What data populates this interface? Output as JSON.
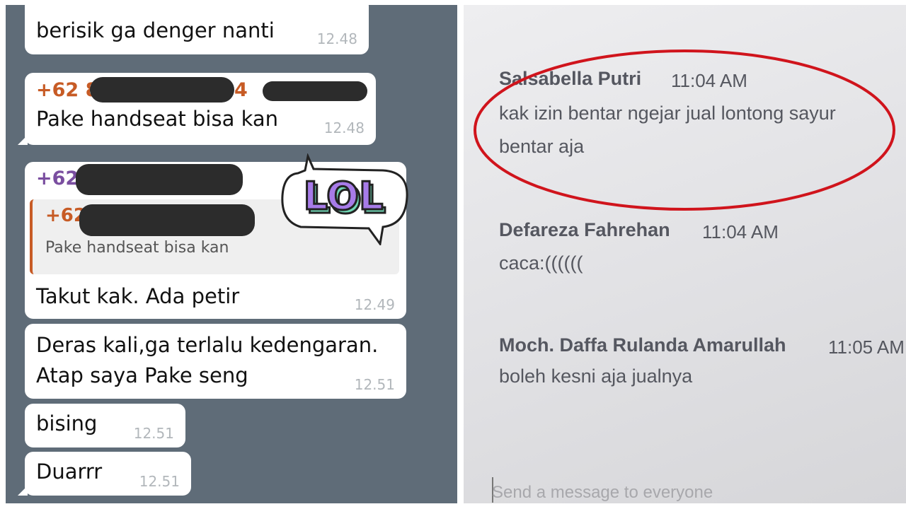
{
  "left_chat": {
    "messages": [
      {
        "text": "berisik ga denger nanti",
        "time": "12.48"
      },
      {
        "sender_prefix": "+62 8",
        "sender_suffix": "4",
        "text": "Pake handseat bisa kan",
        "time": "12.48",
        "sender_color": "#c75b25"
      },
      {
        "sender_prefix": "+62",
        "quote_sender": "+62",
        "quote_text": "Pake handseat bisa kan",
        "text": "Takut kak. Ada petir",
        "time": "12.49",
        "sender_color": "#7a4ea0"
      },
      {
        "text_line1": "Deras kali,ga terlalu kedengaran.",
        "text_line2": "Atap saya Pake seng",
        "time": "12.51"
      },
      {
        "text": "bising",
        "time": "12.51"
      },
      {
        "text": "Duarrr",
        "time": "12.51"
      }
    ],
    "sticker": "LOL",
    "colors": {
      "background": "#5f6c78",
      "bubble": "#ffffff",
      "reply_accent": "#c75b25",
      "sticker_fill": "#a77be8",
      "sticker_shadow": "#6fd6b4"
    }
  },
  "right_chat": {
    "messages": [
      {
        "name": "Salsabella Putri",
        "time": "11:04 AM",
        "line1": "kak izin bentar ngejar jual lontong sayur",
        "line2": "bentar aja"
      },
      {
        "name": "Defareza Fahrehan",
        "time": "11:04 AM",
        "line1": "caca:(((((("
      },
      {
        "name": "Moch. Daffa Rulanda Amarullah",
        "time": "11:05 AM",
        "line1": "boleh kesni aja jualnya"
      }
    ],
    "input_placeholder": "Send a message to everyone",
    "colors": {
      "highlight_ring": "#d0141c"
    }
  }
}
